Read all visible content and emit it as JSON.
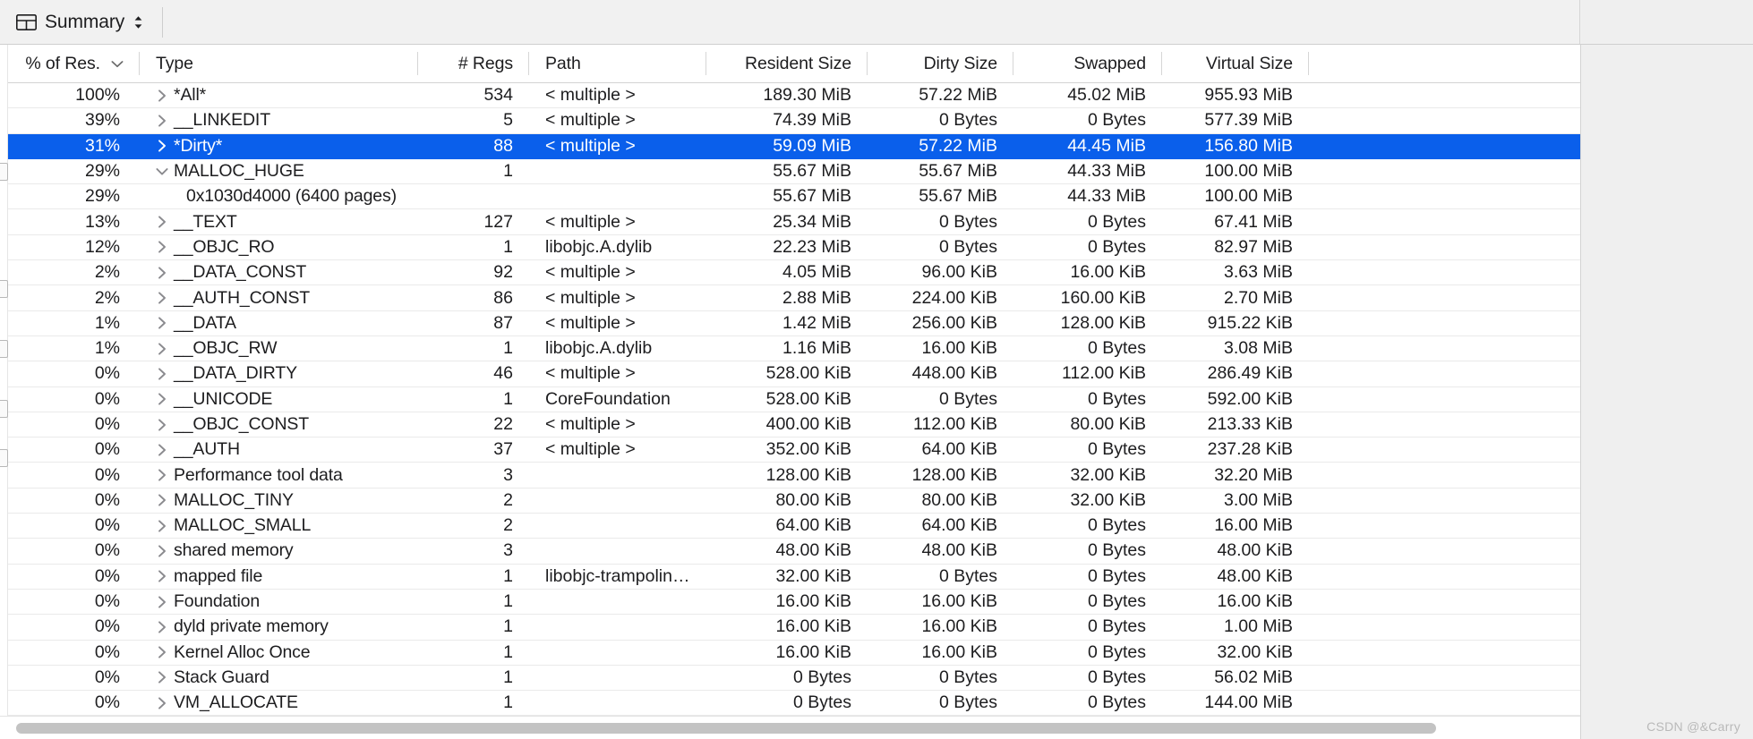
{
  "topbar": {
    "summary_label": "Summary",
    "table_icon": "table-icon",
    "sort_icon": "up-down-chevron-icon"
  },
  "table": {
    "columns": [
      {
        "key": "percent",
        "label": "% of Res.",
        "align": "right"
      },
      {
        "key": "type",
        "label": "Type",
        "align": "left"
      },
      {
        "key": "regs",
        "label": "# Regs",
        "align": "right"
      },
      {
        "key": "path",
        "label": "Path",
        "align": "left"
      },
      {
        "key": "resident",
        "label": "Resident Size",
        "align": "right"
      },
      {
        "key": "dirty",
        "label": "Dirty Size",
        "align": "right"
      },
      {
        "key": "swapped",
        "label": "Swapped",
        "align": "right"
      },
      {
        "key": "virtual",
        "label": "Virtual Size",
        "align": "right"
      }
    ],
    "sorted_column": "% of Res.",
    "sort_direction": "descending",
    "selection_color": "#0a5feb",
    "rows": [
      {
        "percent": "100%",
        "type": "*All*",
        "disclosure": "collapsed",
        "indent": 0,
        "regs": "534",
        "path": "< multiple >",
        "resident": "189.30 MiB",
        "dirty": "57.22 MiB",
        "swapped": "45.02 MiB",
        "virtual": "955.93 MiB",
        "selected": false
      },
      {
        "percent": "39%",
        "type": "__LINKEDIT",
        "disclosure": "collapsed",
        "indent": 0,
        "regs": "5",
        "path": "< multiple >",
        "resident": "74.39 MiB",
        "dirty": "0 Bytes",
        "swapped": "0 Bytes",
        "virtual": "577.39 MiB",
        "selected": false
      },
      {
        "percent": "31%",
        "type": "*Dirty*",
        "disclosure": "collapsed",
        "indent": 0,
        "regs": "88",
        "path": "< multiple >",
        "resident": "59.09 MiB",
        "dirty": "57.22 MiB",
        "swapped": "44.45 MiB",
        "virtual": "156.80 MiB",
        "selected": true
      },
      {
        "percent": "29%",
        "type": "MALLOC_HUGE",
        "disclosure": "expanded",
        "indent": 0,
        "regs": "1",
        "path": "",
        "resident": "55.67 MiB",
        "dirty": "55.67 MiB",
        "swapped": "44.33 MiB",
        "virtual": "100.00 MiB",
        "selected": false
      },
      {
        "percent": "29%",
        "type": "0x1030d4000 (6400 pages)",
        "disclosure": "none",
        "indent": 1,
        "regs": "",
        "path": "",
        "resident": "55.67 MiB",
        "dirty": "55.67 MiB",
        "swapped": "44.33 MiB",
        "virtual": "100.00 MiB",
        "selected": false
      },
      {
        "percent": "13%",
        "type": "__TEXT",
        "disclosure": "collapsed",
        "indent": 0,
        "regs": "127",
        "path": "< multiple >",
        "resident": "25.34 MiB",
        "dirty": "0 Bytes",
        "swapped": "0 Bytes",
        "virtual": "67.41 MiB",
        "selected": false
      },
      {
        "percent": "12%",
        "type": "__OBJC_RO",
        "disclosure": "collapsed",
        "indent": 0,
        "regs": "1",
        "path": "libobjc.A.dylib",
        "resident": "22.23 MiB",
        "dirty": "0 Bytes",
        "swapped": "0 Bytes",
        "virtual": "82.97 MiB",
        "selected": false
      },
      {
        "percent": "2%",
        "type": "__DATA_CONST",
        "disclosure": "collapsed",
        "indent": 0,
        "regs": "92",
        "path": "< multiple >",
        "resident": "4.05 MiB",
        "dirty": "96.00 KiB",
        "swapped": "16.00 KiB",
        "virtual": "3.63 MiB",
        "selected": false
      },
      {
        "percent": "2%",
        "type": "__AUTH_CONST",
        "disclosure": "collapsed",
        "indent": 0,
        "regs": "86",
        "path": "< multiple >",
        "resident": "2.88 MiB",
        "dirty": "224.00 KiB",
        "swapped": "160.00 KiB",
        "virtual": "2.70 MiB",
        "selected": false
      },
      {
        "percent": "1%",
        "type": "__DATA",
        "disclosure": "collapsed",
        "indent": 0,
        "regs": "87",
        "path": "< multiple >",
        "resident": "1.42 MiB",
        "dirty": "256.00 KiB",
        "swapped": "128.00 KiB",
        "virtual": "915.22 KiB",
        "selected": false
      },
      {
        "percent": "1%",
        "type": "__OBJC_RW",
        "disclosure": "collapsed",
        "indent": 0,
        "regs": "1",
        "path": "libobjc.A.dylib",
        "resident": "1.16 MiB",
        "dirty": "16.00 KiB",
        "swapped": "0 Bytes",
        "virtual": "3.08 MiB",
        "selected": false
      },
      {
        "percent": "0%",
        "type": "__DATA_DIRTY",
        "disclosure": "collapsed",
        "indent": 0,
        "regs": "46",
        "path": "< multiple >",
        "resident": "528.00 KiB",
        "dirty": "448.00 KiB",
        "swapped": "112.00 KiB",
        "virtual": "286.49 KiB",
        "selected": false
      },
      {
        "percent": "0%",
        "type": "__UNICODE",
        "disclosure": "collapsed",
        "indent": 0,
        "regs": "1",
        "path": "CoreFoundation",
        "resident": "528.00 KiB",
        "dirty": "0 Bytes",
        "swapped": "0 Bytes",
        "virtual": "592.00 KiB",
        "selected": false
      },
      {
        "percent": "0%",
        "type": "__OBJC_CONST",
        "disclosure": "collapsed",
        "indent": 0,
        "regs": "22",
        "path": "< multiple >",
        "resident": "400.00 KiB",
        "dirty": "112.00 KiB",
        "swapped": "80.00 KiB",
        "virtual": "213.33 KiB",
        "selected": false
      },
      {
        "percent": "0%",
        "type": "__AUTH",
        "disclosure": "collapsed",
        "indent": 0,
        "regs": "37",
        "path": "< multiple >",
        "resident": "352.00 KiB",
        "dirty": "64.00 KiB",
        "swapped": "0 Bytes",
        "virtual": "237.28 KiB",
        "selected": false
      },
      {
        "percent": "0%",
        "type": "Performance tool data",
        "disclosure": "collapsed",
        "indent": 0,
        "regs": "3",
        "path": "",
        "resident": "128.00 KiB",
        "dirty": "128.00 KiB",
        "swapped": "32.00 KiB",
        "virtual": "32.20 MiB",
        "selected": false
      },
      {
        "percent": "0%",
        "type": "MALLOC_TINY",
        "disclosure": "collapsed",
        "indent": 0,
        "regs": "2",
        "path": "",
        "resident": "80.00 KiB",
        "dirty": "80.00 KiB",
        "swapped": "32.00 KiB",
        "virtual": "3.00 MiB",
        "selected": false
      },
      {
        "percent": "0%",
        "type": "MALLOC_SMALL",
        "disclosure": "collapsed",
        "indent": 0,
        "regs": "2",
        "path": "",
        "resident": "64.00 KiB",
        "dirty": "64.00 KiB",
        "swapped": "0 Bytes",
        "virtual": "16.00 MiB",
        "selected": false
      },
      {
        "percent": "0%",
        "type": "shared memory",
        "disclosure": "collapsed",
        "indent": 0,
        "regs": "3",
        "path": "",
        "resident": "48.00 KiB",
        "dirty": "48.00 KiB",
        "swapped": "0 Bytes",
        "virtual": "48.00 KiB",
        "selected": false
      },
      {
        "percent": "0%",
        "type": "mapped file",
        "disclosure": "collapsed",
        "indent": 0,
        "regs": "1",
        "path": "libobjc-trampolin…",
        "resident": "32.00 KiB",
        "dirty": "0 Bytes",
        "swapped": "0 Bytes",
        "virtual": "48.00 KiB",
        "selected": false
      },
      {
        "percent": "0%",
        "type": "Foundation",
        "disclosure": "collapsed",
        "indent": 0,
        "regs": "1",
        "path": "",
        "resident": "16.00 KiB",
        "dirty": "16.00 KiB",
        "swapped": "0 Bytes",
        "virtual": "16.00 KiB",
        "selected": false
      },
      {
        "percent": "0%",
        "type": "dyld private memory",
        "disclosure": "collapsed",
        "indent": 0,
        "regs": "1",
        "path": "",
        "resident": "16.00 KiB",
        "dirty": "16.00 KiB",
        "swapped": "0 Bytes",
        "virtual": "1.00 MiB",
        "selected": false
      },
      {
        "percent": "0%",
        "type": "Kernel Alloc Once",
        "disclosure": "collapsed",
        "indent": 0,
        "regs": "1",
        "path": "",
        "resident": "16.00 KiB",
        "dirty": "16.00 KiB",
        "swapped": "0 Bytes",
        "virtual": "32.00 KiB",
        "selected": false
      },
      {
        "percent": "0%",
        "type": "Stack Guard",
        "disclosure": "collapsed",
        "indent": 0,
        "regs": "1",
        "path": "",
        "resident": "0 Bytes",
        "dirty": "0 Bytes",
        "swapped": "0 Bytes",
        "virtual": "56.02 MiB",
        "selected": false
      },
      {
        "percent": "0%",
        "type": "VM_ALLOCATE",
        "disclosure": "collapsed",
        "indent": 0,
        "regs": "1",
        "path": "",
        "resident": "0 Bytes",
        "dirty": "0 Bytes",
        "swapped": "0 Bytes",
        "virtual": "144.00 MiB",
        "selected": false
      }
    ]
  },
  "watermark": "CSDN @&Carry"
}
